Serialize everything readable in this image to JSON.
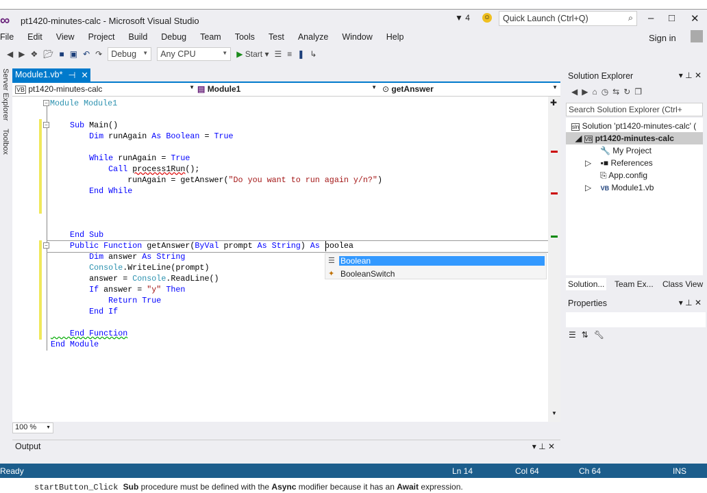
{
  "window": {
    "title": "pt1420-minutes-calc - Microsoft Visual Studio",
    "notifications": "4",
    "quick_launch_placeholder": "Quick Launch (Ctrl+Q)",
    "sign_in": "Sign in",
    "minimize": "–",
    "maximize": "□",
    "close": "✕"
  },
  "menu": [
    "File",
    "Edit",
    "View",
    "Project",
    "Build",
    "Debug",
    "Team",
    "Tools",
    "Test",
    "Analyze",
    "Window",
    "Help"
  ],
  "toolbar": {
    "config": "Debug",
    "platform": "Any CPU",
    "start": "Start"
  },
  "left_sidebar": {
    "server_explorer": "Server Explorer",
    "toolbox": "Toolbox"
  },
  "tab": {
    "label": "Module1.vb*",
    "pin": "⊣",
    "close": "✕"
  },
  "navbar": {
    "project": "pt1420-minutes-calc",
    "type": "Module1",
    "member": "getAnswer"
  },
  "code": [
    [
      [
        "Module ",
        "ty"
      ],
      [
        "Module1",
        "ty"
      ]
    ],
    [],
    [
      [
        "    Sub ",
        "kw"
      ],
      [
        "Main()",
        "tx"
      ]
    ],
    [
      [
        "        Dim ",
        "kw"
      ],
      [
        "runAgain ",
        "tx"
      ],
      [
        "As ",
        "kw"
      ],
      [
        "Boolean ",
        "kw"
      ],
      [
        "= ",
        "tx"
      ],
      [
        "True",
        "kw"
      ]
    ],
    [],
    [
      [
        "        While ",
        "kw"
      ],
      [
        "runAgain = ",
        "tx"
      ],
      [
        "True",
        "kw"
      ]
    ],
    [
      [
        "            Call ",
        "kw"
      ],
      [
        "process1Run",
        "sqr"
      ],
      [
        "();",
        "tx"
      ]
    ],
    [
      [
        "                runAgain = getAnswer(",
        "tx"
      ],
      [
        "\"Do you want to run again y/n?\"",
        "str"
      ],
      [
        ")",
        "tx"
      ]
    ],
    [
      [
        "        End While",
        "kw"
      ]
    ],
    [],
    [],
    [],
    [
      [
        "    End Sub",
        "kw"
      ]
    ],
    [
      [
        "    Public Function ",
        "kw"
      ],
      [
        "getAnswer(",
        "tx"
      ],
      [
        "ByVal ",
        "kw"
      ],
      [
        "prompt ",
        "tx"
      ],
      [
        "As ",
        "kw"
      ],
      [
        "String",
        "kw"
      ],
      [
        ") ",
        "tx"
      ],
      [
        "As ",
        "kw"
      ],
      [
        "boolea",
        "tx"
      ]
    ],
    [
      [
        "        Dim ",
        "kw"
      ],
      [
        "answer ",
        "tx"
      ],
      [
        "As ",
        "kw"
      ],
      [
        "String",
        "kw"
      ]
    ],
    [
      [
        "        Console",
        "ty"
      ],
      [
        ".WriteLine(prompt)",
        "tx"
      ]
    ],
    [
      [
        "        answer = ",
        "tx"
      ],
      [
        "Console",
        "ty"
      ],
      [
        ".ReadLine()",
        "tx"
      ]
    ],
    [
      [
        "        If ",
        "kw"
      ],
      [
        "answer = ",
        "tx"
      ],
      [
        "\"y\" ",
        "str"
      ],
      [
        "Then",
        "kw"
      ]
    ],
    [
      [
        "            Return True",
        "kw"
      ]
    ],
    [
      [
        "        End If",
        "kw"
      ]
    ],
    [],
    [
      [
        "    End Function",
        "kw"
      ]
    ],
    [
      [
        "End Module",
        "kw"
      ]
    ]
  ],
  "intellisense": [
    {
      "label": "Boolean",
      "selected": true
    },
    {
      "label": "BooleanSwitch",
      "selected": false
    }
  ],
  "editor": {
    "zoom": "100 %"
  },
  "output": {
    "title": "Output"
  },
  "solution_explorer": {
    "title": "Solution Explorer",
    "search_placeholder": "Search Solution Explorer (Ctrl+",
    "items": [
      {
        "label": "Solution 'pt1420-minutes-calc' (",
        "icon": "sln"
      },
      {
        "label": "pt1420-minutes-calc",
        "icon": "VB"
      },
      {
        "label": "My Project",
        "icon": "🔧"
      },
      {
        "label": "References",
        "icon": "▪■"
      },
      {
        "label": "App.config",
        "icon": "⎘"
      },
      {
        "label": "Module1.vb",
        "icon": "VB"
      }
    ],
    "tabs": [
      "Solution...",
      "Team Ex...",
      "Class View"
    ]
  },
  "properties": {
    "title": "Properties"
  },
  "status": {
    "state": "Ready",
    "ln": "Ln 14",
    "col": "Col 64",
    "ch": "Ch 64",
    "mode": "INS"
  },
  "caption": {
    "pre": "startButton_Click ",
    "b1": "Sub",
    "mid": " procedure must be defined with the ",
    "b2": "Async",
    "mid2": " modifier because it has an ",
    "b3": "Await",
    "post": " expression."
  }
}
